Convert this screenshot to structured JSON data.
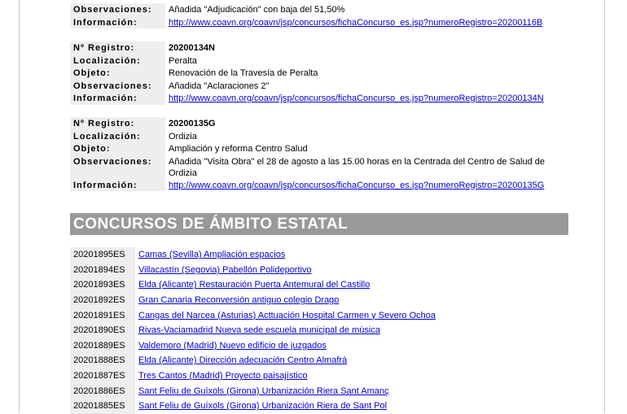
{
  "labels": {
    "registro": "Nº Registro:",
    "localizacion": "Localización:",
    "objeto": "Objeto:",
    "observaciones": "Observaciones:",
    "informacion": "Información:"
  },
  "record_top": {
    "observaciones": "Añadida \"Adjudicación\" con baja del 51,50%",
    "informacion": "http://www.coavn.org/coavn/jsp/concursos/fichaConcurso_es.jsp?numeroRegistro=20200116B"
  },
  "records": [
    {
      "registro": "20200134N",
      "localizacion": "Peralta",
      "objeto": "Renovación de la Travesía de Peralta",
      "observaciones": "Añadida \"Aclaraciones 2\"",
      "informacion": "http://www.coavn.org/coavn/jsp/concursos/fichaConcurso_es.jsp?numeroRegistro=20200134N"
    },
    {
      "registro": "20200135G",
      "localizacion": "Ordizia",
      "objeto": "Ampliación y reforma Centro Salud",
      "observaciones": "Añadida \"Visita Obra\" el 28 de agosto a las 15.00 horas en la Centrada del Centro de Salud de Ordizia",
      "informacion": "http://www.coavn.org/coavn/jsp/concursos/fichaConcurso_es.jsp?numeroRegistro=20200135G"
    }
  ],
  "section_title": "CONCURSOS DE ÁMBITO ESTATAL",
  "estatal": [
    {
      "code": "20201895ES",
      "text": "Camas (Sevilla) Ampliación espacios "
    },
    {
      "code": "20201894ES",
      "text": "Villacastín (Segovia) Pabellón Polideportivo"
    },
    {
      "code": "20201893ES",
      "text": "Elda (Alicante) Restauración Puerta Antemural del Castillo "
    },
    {
      "code": "20201892ES",
      "text": "Gran Canaria Reconversión antiguo colegio Drago"
    },
    {
      "code": "20201891ES",
      "text": "Cangas del Narcea (Asturias) Acttuación Hospital Carmen y Severo Ochoa "
    },
    {
      "code": "20201890ES",
      "text": "Rivas-Vaciamadrid Nueva sede escuela municipal de música "
    },
    {
      "code": "20201889ES",
      "text": "Valdemoro (Madrid) Nuevo edificio de juzgados "
    },
    {
      "code": "20201888ES",
      "text": "Elda (Alicante) Dirección adecuación Centro Almafrá"
    },
    {
      "code": "20201887ES",
      "text": "Tres Cantos (Madrid) Proyecto paisajístico"
    },
    {
      "code": "20201886ES",
      "text": "Sant Feliu de Guíxols (Girona) Urbanización Riera Sant Amanç"
    },
    {
      "code": "20201885ES",
      "text": "Sant Feliu de Guíxols (Girona) Urbanización Riera de Sant Pol"
    }
  ]
}
